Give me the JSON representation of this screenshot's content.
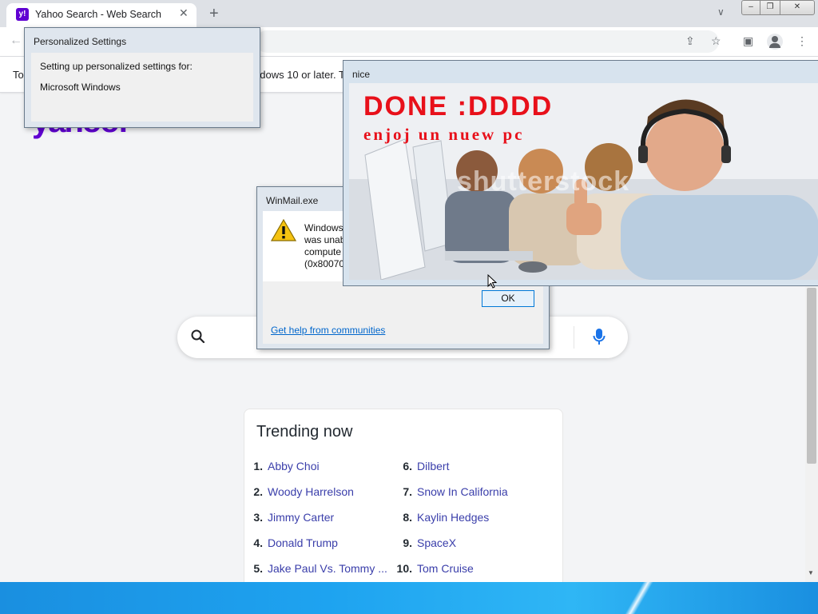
{
  "browser": {
    "tab_title": "Yahoo Search - Web Search",
    "favicon_text": "y!",
    "new_tab_symbol": "+",
    "close_tab_symbol": "✕",
    "infobar_text_left": "To",
    "infobar_text_right": "ndows 10 or later. T"
  },
  "page": {
    "logo": "yahoo!",
    "trending": {
      "title": "Trending now",
      "items": [
        {
          "num": "1.",
          "label": "Abby Choi"
        },
        {
          "num": "2.",
          "label": "Woody Harrelson"
        },
        {
          "num": "3.",
          "label": "Jimmy Carter"
        },
        {
          "num": "4.",
          "label": "Donald Trump"
        },
        {
          "num": "5.",
          "label": "Jake Paul Vs. Tommy ..."
        },
        {
          "num": "6.",
          "label": "Dilbert"
        },
        {
          "num": "7.",
          "label": "Snow In California"
        },
        {
          "num": "8.",
          "label": "Kaylin Hedges"
        },
        {
          "num": "9.",
          "label": "SpaceX"
        },
        {
          "num": "10.",
          "label": "Tom Cruise"
        }
      ]
    }
  },
  "dialogs": {
    "personalized": {
      "title": "Personalized Settings",
      "line1": "Setting up personalized settings for:",
      "line2": "Microsoft Windows"
    },
    "winmail": {
      "title": "WinMail.exe",
      "message": "Windows\nwas unab\ncompute\n(0x800700",
      "ok_label": "OK",
      "help_link": "Get help from communities"
    },
    "nice": {
      "title": "nice",
      "image_text_line1": "DONE :DDDD",
      "image_text_line2": "enjoj un nuew pc",
      "watermark": "shutterstock"
    }
  },
  "colors": {
    "yahoo_purple": "#6001d2",
    "link_blue": "#3a3eaa",
    "meme_red": "#e8101a",
    "taskbar_blue": "#1ea3f0"
  }
}
